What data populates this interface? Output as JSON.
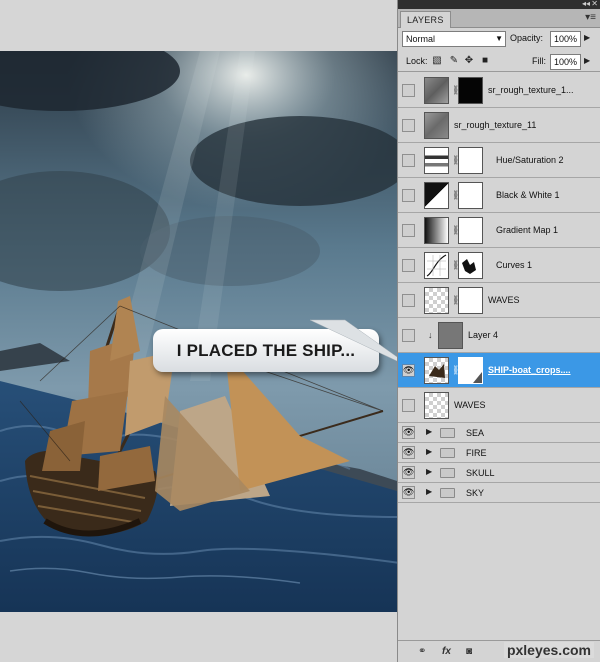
{
  "canvas": {
    "callout_text": "I PLACED THE SHIP..."
  },
  "panel": {
    "tab_label": "LAYERS",
    "collapse_icon": "double-chevron-icon",
    "close_icon": "close-icon",
    "menu_icon": "panel-menu-icon",
    "blend_mode": "Normal",
    "opacity_label": "Opacity:",
    "opacity_value": "100%",
    "lock_label": "Lock:",
    "fill_label": "Fill:",
    "fill_value": "100%",
    "lock_icons": [
      "lock-transparent-icon",
      "lock-paint-brush-icon",
      "lock-move-icon",
      "lock-all-icon"
    ]
  },
  "layers": [
    {
      "name": "sr_rough_texture_1...",
      "visible": false,
      "kind": "masked-texture"
    },
    {
      "name": "sr_rough_texture_11",
      "visible": false,
      "kind": "texture"
    },
    {
      "name": "Hue/Saturation 2",
      "visible": false,
      "kind": "adjustment"
    },
    {
      "name": "Black & White 1",
      "visible": false,
      "kind": "adjustment"
    },
    {
      "name": "Gradient Map 1",
      "visible": false,
      "kind": "adjustment"
    },
    {
      "name": "Curves 1",
      "visible": false,
      "kind": "adjustment"
    },
    {
      "name": "WAVES",
      "visible": false,
      "kind": "masked"
    },
    {
      "name": "Layer 4",
      "visible": false,
      "kind": "clipped"
    },
    {
      "name": "SHIP-boat_crops....",
      "visible": true,
      "kind": "masked",
      "selected": true
    },
    {
      "name": "WAVES",
      "visible": false,
      "kind": "pixel"
    }
  ],
  "groups": [
    {
      "name": "SEA",
      "visible": true
    },
    {
      "name": "FIRE",
      "visible": true
    },
    {
      "name": "SKULL",
      "visible": true
    },
    {
      "name": "SKY",
      "visible": true
    }
  ],
  "bottom_icons": [
    "link-layers-icon",
    "fx-icon",
    "add-mask-icon"
  ],
  "watermark": "pxleyes.com",
  "colors": {
    "selection": "#3b98e6",
    "panel": "#d4d4d4"
  }
}
